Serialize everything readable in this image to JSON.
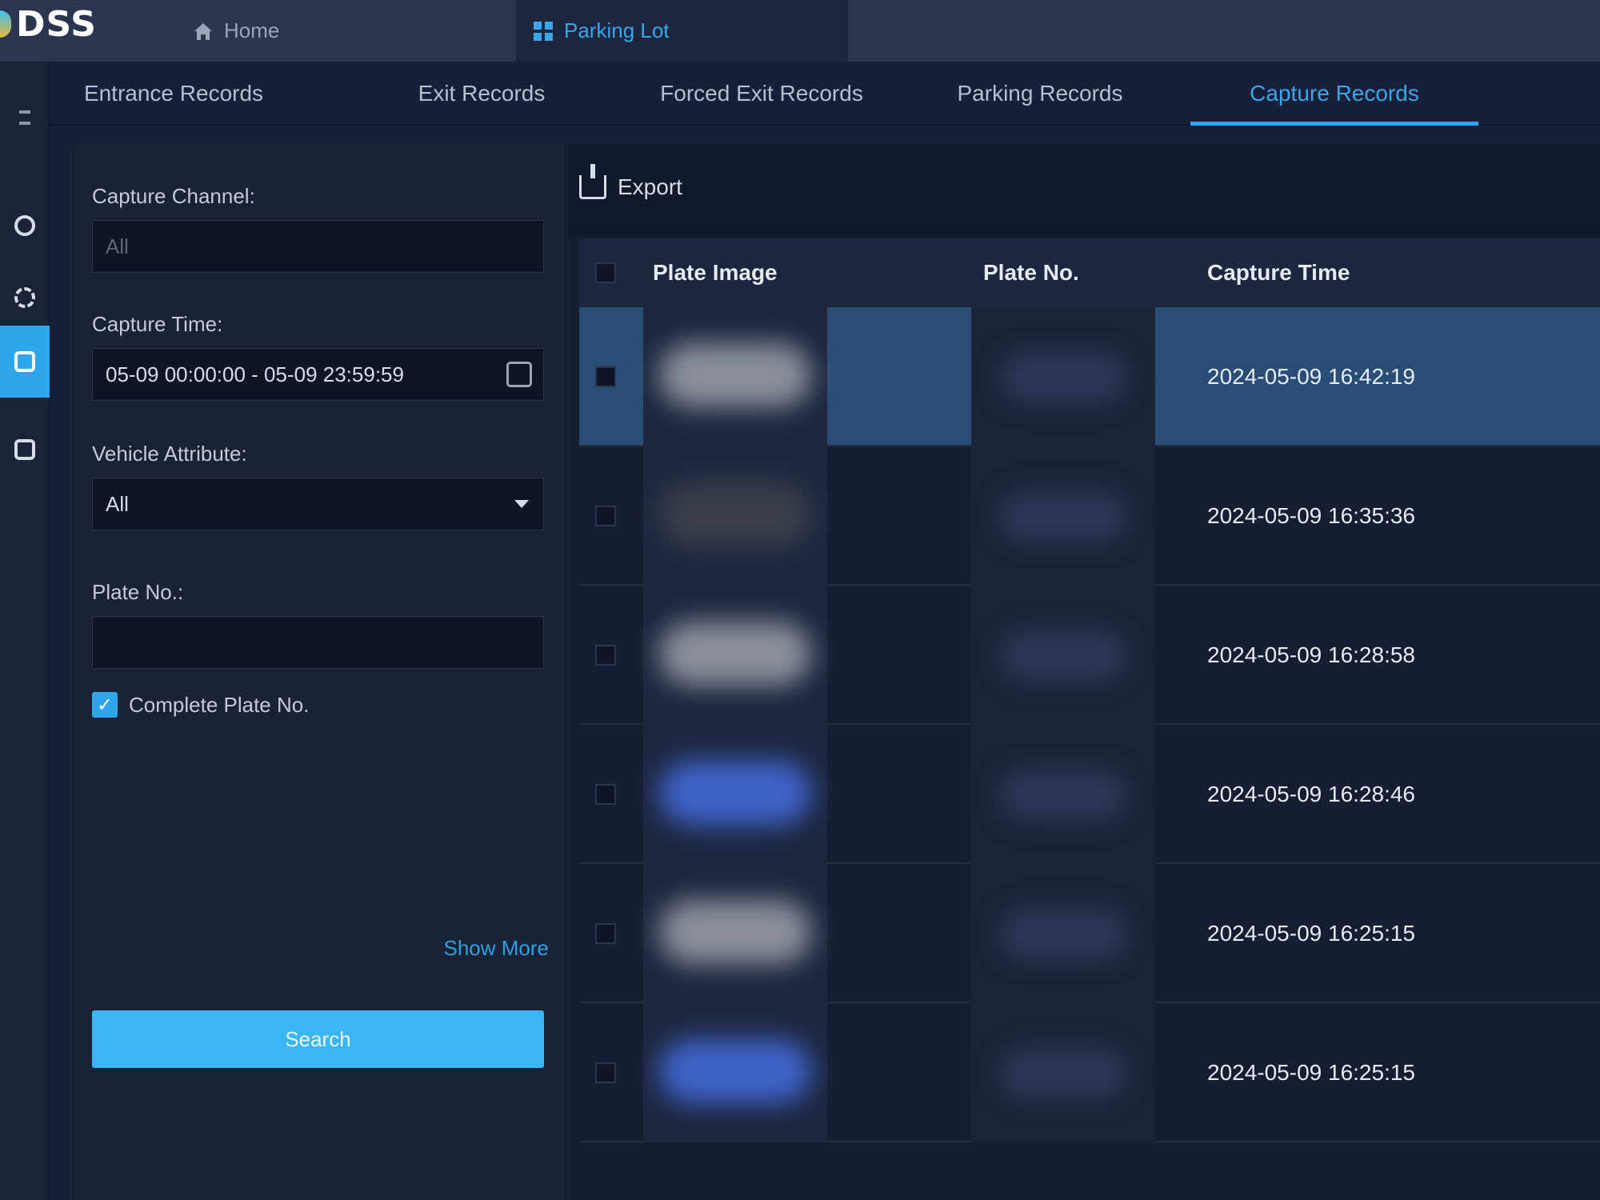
{
  "app": {
    "logo": "DSS",
    "tabs": [
      {
        "label": "Home",
        "icon": "home-icon"
      },
      {
        "label": "Parking Lot",
        "icon": "grid-icon",
        "active": true
      }
    ]
  },
  "subtabs": [
    {
      "label": "Entrance Records"
    },
    {
      "label": "Exit Records"
    },
    {
      "label": "Forced Exit Records"
    },
    {
      "label": "Parking Records"
    },
    {
      "label": "Capture Records",
      "active": true
    }
  ],
  "filter": {
    "capture_channel_label": "Capture Channel:",
    "capture_channel_placeholder": "All",
    "capture_time_label": "Capture Time:",
    "capture_time_value": "05-09 00:00:00 - 05-09 23:59:59",
    "vehicle_attribute_label": "Vehicle Attribute:",
    "vehicle_attribute_value": "All",
    "plate_no_label": "Plate No.:",
    "plate_no_value": "",
    "complete_plate_label": "Complete Plate No.",
    "complete_plate_checked": true,
    "show_more": "Show More",
    "search": "Search"
  },
  "toolbar": {
    "export": "Export"
  },
  "table": {
    "columns": [
      "Plate Image",
      "Plate No.",
      "Capture Time"
    ],
    "rows": [
      {
        "capture_time": "2024-05-09 16:42:19",
        "selected": true
      },
      {
        "capture_time": "2024-05-09 16:35:36"
      },
      {
        "capture_time": "2024-05-09 16:28:58"
      },
      {
        "capture_time": "2024-05-09 16:28:46"
      },
      {
        "capture_time": "2024-05-09 16:25:15"
      },
      {
        "capture_time": "2024-05-09 16:25:15"
      }
    ]
  },
  "colors": {
    "accent": "#2ea6ea",
    "background": "#17203a",
    "selected_row": "#2a4d75"
  }
}
